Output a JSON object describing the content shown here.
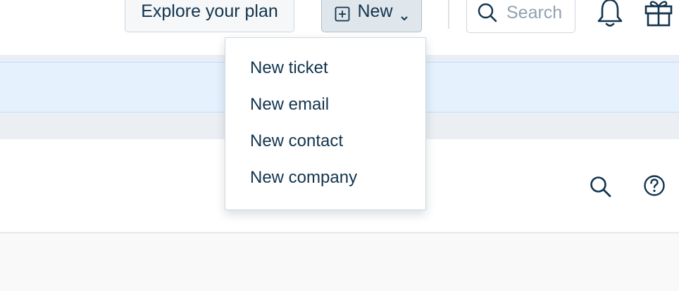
{
  "header": {
    "explore_label": "Explore your plan",
    "new_label": "New",
    "search_placeholder": "Search"
  },
  "dropdown": {
    "items": [
      {
        "label": "New ticket"
      },
      {
        "label": "New email"
      },
      {
        "label": "New contact"
      },
      {
        "label": "New company"
      }
    ]
  },
  "icons": [
    "plus-square-icon",
    "chevron-down-icon",
    "search-icon",
    "bell-icon",
    "gift-icon",
    "help-icon"
  ],
  "colors": {
    "text": "#12344d",
    "placeholder": "#92a2b1",
    "banner_bg": "#e5f2fd",
    "banner_border": "#bbdcfe",
    "band_bg": "#ebeff3"
  }
}
